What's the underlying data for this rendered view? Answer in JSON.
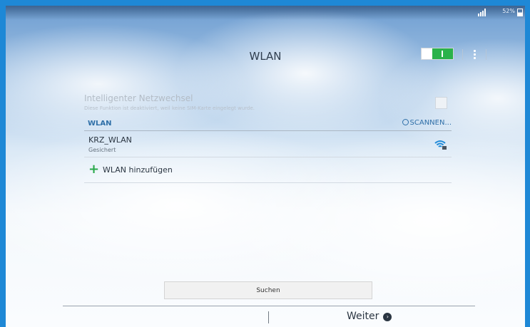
{
  "status_bar": {
    "battery_percent": "52%",
    "battery_level": 0.52
  },
  "action_bar": {
    "title": "WLAN",
    "toggle_label": "I",
    "toggle_on": true
  },
  "smart_network": {
    "title": "Intelligenter Netzwechsel",
    "description": "Diese Funktion ist deaktiviert, weil keine SIM-Karte eingelegt wurde."
  },
  "wlan_section": {
    "label": "WLAN",
    "scan_label": "SCANNEN..."
  },
  "networks": [
    {
      "name": "KRZ_WLAN",
      "status": "Gesichert",
      "icon": "wifi-secured-icon"
    }
  ],
  "add_network": {
    "icon": "+",
    "label": "WLAN hinzufügen"
  },
  "buttons": {
    "search": "Suchen",
    "next": "Weiter",
    "next_icon": "›"
  },
  "colors": {
    "accent": "#2f6fa8",
    "toggle_on": "#2bb24a",
    "plus": "#29a84a",
    "frame": "#1e88d6"
  }
}
